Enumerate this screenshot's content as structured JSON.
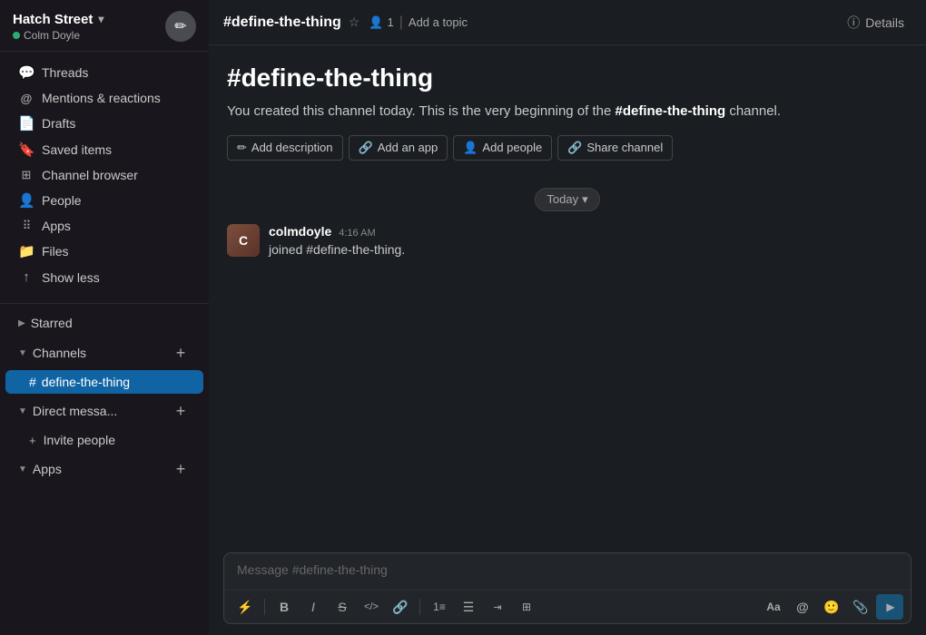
{
  "sidebar": {
    "workspace": {
      "name": "Hatch Street",
      "chevron": "▾"
    },
    "user": {
      "name": "Colm Doyle",
      "status": "online"
    },
    "compose_button_label": "✏",
    "nav_items": [
      {
        "id": "threads",
        "icon": "💬",
        "icon_name": "threads-icon",
        "label": "Threads"
      },
      {
        "id": "mentions",
        "icon": "＠",
        "icon_name": "mentions-icon",
        "label": "Mentions & reactions"
      },
      {
        "id": "drafts",
        "icon": "📄",
        "icon_name": "drafts-icon",
        "label": "Drafts"
      },
      {
        "id": "saved",
        "icon": "🔖",
        "icon_name": "saved-icon",
        "label": "Saved items"
      },
      {
        "id": "channels",
        "icon": "🔍",
        "icon_name": "channel-browser-icon",
        "label": "Channel browser"
      },
      {
        "id": "people",
        "icon": "👤",
        "icon_name": "people-icon",
        "label": "People"
      },
      {
        "id": "apps",
        "icon": "⠿",
        "icon_name": "apps-icon",
        "label": "Apps"
      },
      {
        "id": "files",
        "icon": "📁",
        "icon_name": "files-icon",
        "label": "Files"
      },
      {
        "id": "show_less",
        "icon": "↑",
        "icon_name": "show-less-icon",
        "label": "Show less"
      }
    ],
    "sections": {
      "starred": {
        "label": "Starred",
        "arrow": "▶"
      },
      "channels": {
        "label": "Channels",
        "arrow": "▼",
        "add_label": "+",
        "items": [
          {
            "id": "define-the-thing",
            "name": "define-the-thing",
            "active": true
          }
        ]
      },
      "direct_messages": {
        "label": "Direct messa...",
        "arrow": "▼",
        "add_label": "+",
        "items": [
          {
            "id": "invite-people",
            "name": "Invite people"
          }
        ]
      },
      "apps": {
        "label": "Apps",
        "arrow": "▼",
        "add_label": "+"
      }
    }
  },
  "header": {
    "channel_name": "#define-the-thing",
    "star_icon": "☆",
    "member_count": "1",
    "add_topic": "Add a topic",
    "details_label": "Details",
    "info_icon": "ⓘ"
  },
  "channel_intro": {
    "title": "#define-the-thing",
    "description_prefix": "You created this channel today. This is the very beginning of the ",
    "description_bold": "#define-the-thing",
    "description_suffix": " channel.",
    "actions": [
      {
        "id": "add-description",
        "icon": "✏",
        "label": "Add description"
      },
      {
        "id": "add-app",
        "icon": "🔗",
        "label": "Add an app"
      },
      {
        "id": "add-people",
        "icon": "👤",
        "label": "Add people"
      },
      {
        "id": "share-channel",
        "icon": "🔗",
        "label": "Share channel"
      }
    ]
  },
  "date_separator": {
    "label": "Today",
    "chevron": "▾"
  },
  "message": {
    "author": "colmdoyle",
    "time": "4:16 AM",
    "text": "joined #define-the-thing.",
    "avatar_initials": "C"
  },
  "composer": {
    "placeholder": "Message #define-the-thing",
    "toolbar_buttons": [
      {
        "id": "lightning",
        "symbol": "⚡",
        "name": "lightning-button"
      },
      {
        "id": "bold",
        "symbol": "B",
        "name": "bold-button"
      },
      {
        "id": "italic",
        "symbol": "I",
        "name": "italic-button"
      },
      {
        "id": "strikethrough",
        "symbol": "S̶",
        "name": "strikethrough-button"
      },
      {
        "id": "code",
        "symbol": "</>",
        "name": "code-button"
      },
      {
        "id": "link",
        "symbol": "🔗",
        "name": "link-button"
      },
      {
        "id": "ordered-list",
        "symbol": "≡",
        "name": "ordered-list-button"
      },
      {
        "id": "unordered-list",
        "symbol": "☰",
        "name": "unordered-list-button"
      },
      {
        "id": "outdent",
        "symbol": "⇤",
        "name": "outdent-button"
      },
      {
        "id": "more-format",
        "symbol": "⊞",
        "name": "more-format-button"
      }
    ],
    "right_buttons": [
      {
        "id": "format",
        "symbol": "Aa",
        "name": "format-button"
      },
      {
        "id": "mention",
        "symbol": "@",
        "name": "mention-button"
      },
      {
        "id": "emoji",
        "symbol": "🙂",
        "name": "emoji-button"
      },
      {
        "id": "attachment",
        "symbol": "📎",
        "name": "attachment-button"
      }
    ],
    "send_icon": "▶"
  },
  "colors": {
    "sidebar_bg": "#19171d",
    "main_bg": "#1a1d21",
    "active_channel": "#1164a3",
    "online_green": "#2bac76"
  }
}
